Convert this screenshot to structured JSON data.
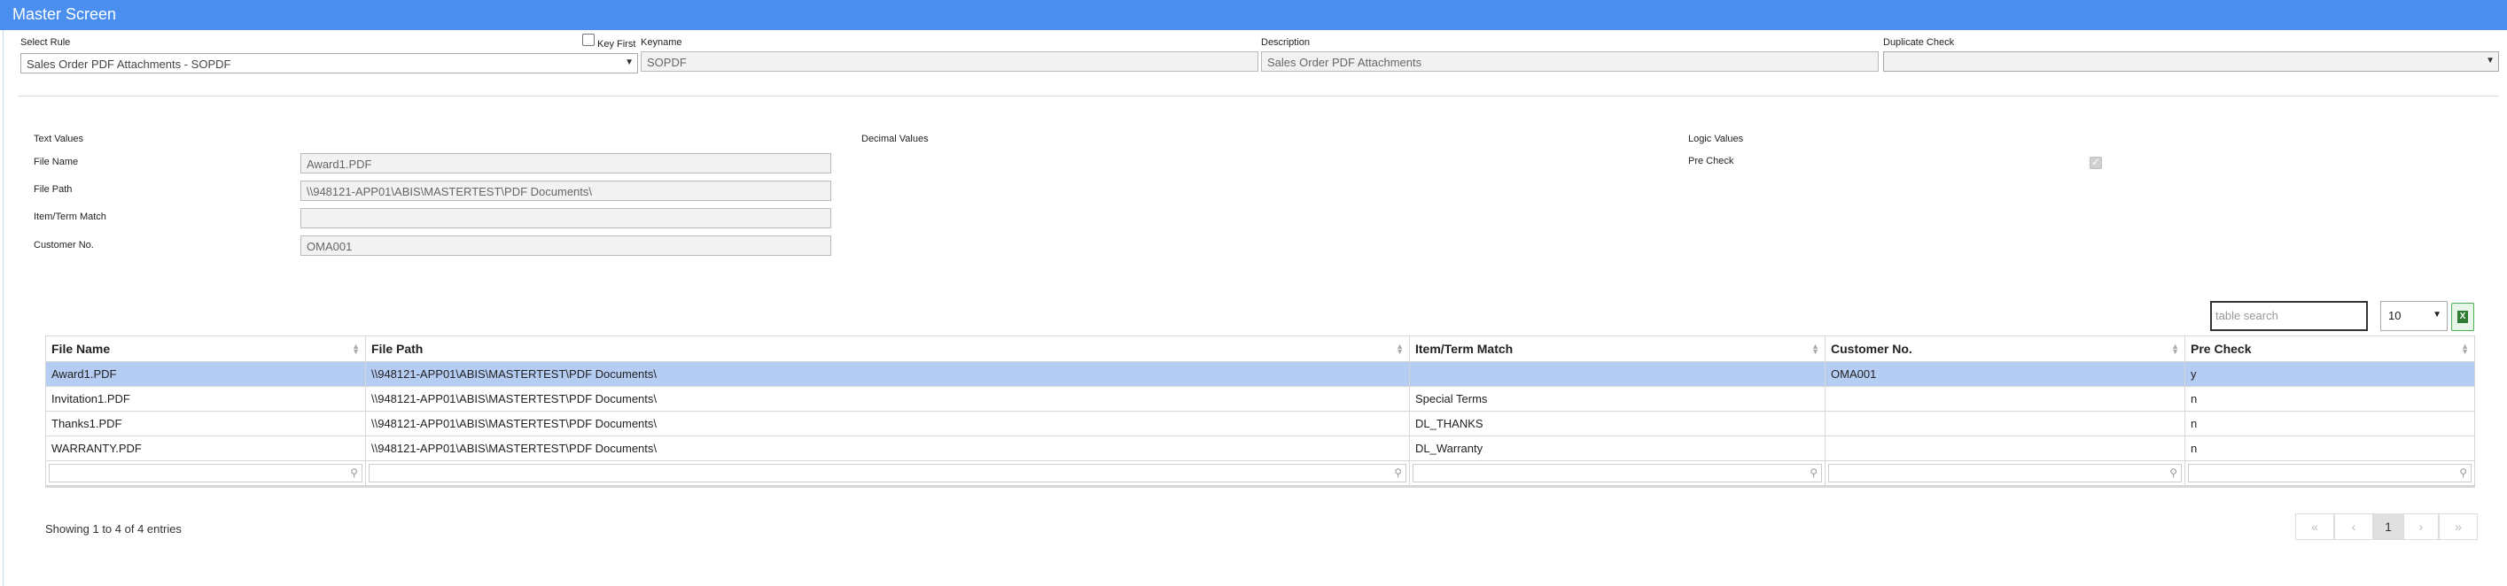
{
  "window": {
    "title": "Master Screen"
  },
  "header_form": {
    "select_rule": {
      "label": "Select Rule",
      "value": "Sales Order PDF Attachments - SOPDF"
    },
    "key_first": {
      "label": "Key First",
      "checked": false
    },
    "keyname": {
      "label": "Keyname",
      "value": "SOPDF"
    },
    "description": {
      "label": "Description",
      "value": "Sales Order PDF Attachments"
    },
    "duplicate_check": {
      "label": "Duplicate Check",
      "value": ""
    }
  },
  "text_values": {
    "title": "Text Values",
    "fields": [
      {
        "label": "File Name",
        "value": "Award1.PDF"
      },
      {
        "label": "File Path",
        "value": "\\\\948121-APP01\\ABIS\\MASTERTEST\\PDF Documents\\"
      },
      {
        "label": "Item/Term Match",
        "value": ""
      },
      {
        "label": "Customer No.",
        "value": "OMA001"
      }
    ]
  },
  "decimal_values": {
    "title": "Decimal Values"
  },
  "logic_values": {
    "title": "Logic Values",
    "fields": [
      {
        "label": "Pre Check",
        "checked": true
      }
    ]
  },
  "table": {
    "search_placeholder": "table search",
    "page_length": "10",
    "export_icon": "excel-export-icon",
    "columns": [
      "File Name",
      "File Path",
      "Item/Term Match",
      "Customer No.",
      "Pre Check"
    ],
    "rows": [
      [
        "Award1.PDF",
        "\\\\948121-APP01\\ABIS\\MASTERTEST\\PDF Documents\\",
        "",
        "OMA001",
        "y"
      ],
      [
        "Invitation1.PDF",
        "\\\\948121-APP01\\ABIS\\MASTERTEST\\PDF Documents\\",
        "Special Terms",
        "",
        "n"
      ],
      [
        "Thanks1.PDF",
        "\\\\948121-APP01\\ABIS\\MASTERTEST\\PDF Documents\\",
        "DL_THANKS",
        "",
        "n"
      ],
      [
        "WARRANTY.PDF",
        "\\\\948121-APP01\\ABIS\\MASTERTEST\\PDF Documents\\",
        "DL_Warranty",
        "",
        "n"
      ]
    ],
    "selected_row": 0,
    "info": "Showing 1 to 4 of 4 entries",
    "pagination": {
      "first": "«",
      "prev": "‹",
      "current": "1",
      "next": "›",
      "last": "»"
    }
  },
  "colors": {
    "titlebar": "#4a8ef0",
    "selected_row": "#b5ccf3"
  }
}
